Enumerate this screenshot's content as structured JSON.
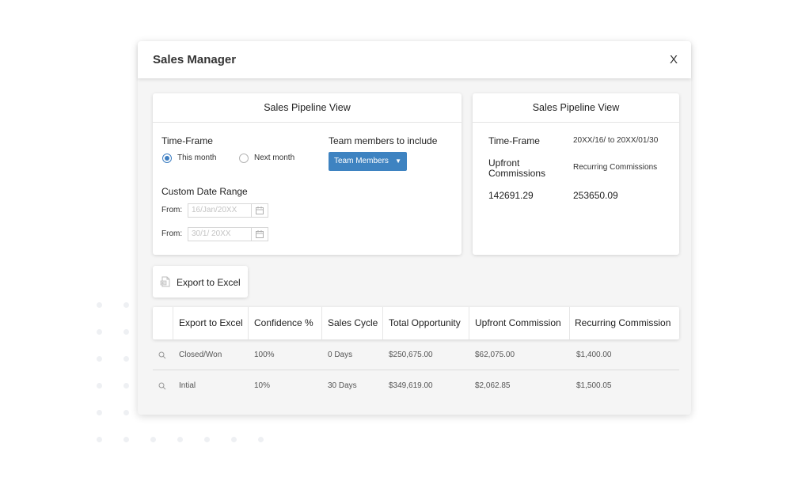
{
  "modal": {
    "title": "Sales Manager",
    "close_label": "X"
  },
  "filter_card": {
    "title": "Sales Pipeline View",
    "timeframe_label": "Time-Frame",
    "timeframe_options": [
      "This month",
      "Next month"
    ],
    "timeframe_selected": "This month",
    "team_label": "Team members to include",
    "team_button": "Team Members",
    "custom_range_label": "Custom Date Range",
    "from_label_1": "From:",
    "from_value_1": "16/Jan/20XX",
    "from_label_2": "From:",
    "from_value_2": "30/1/ 20XX"
  },
  "summary_card": {
    "title": "Sales Pipeline View",
    "timeframe_label": "Time-Frame",
    "timeframe_value": "20XX/16/ to 20XX/01/30",
    "upfront_label": "Upfront Commissions",
    "recurring_label": "Recurring Commissions",
    "upfront_value": "142691.29",
    "recurring_value": "253650.09"
  },
  "export_button": "Export to Excel",
  "table": {
    "columns": [
      "Export to Excel",
      "Confidence %",
      "Sales Cycle",
      "Total Opportunity",
      "Upfront Commission",
      "Recurring Commission"
    ],
    "rows": [
      [
        "Closed/Won",
        "100%",
        "0 Days",
        "$250,675.00",
        "$62,075.00",
        "$1,400.00"
      ],
      [
        "Intial",
        "10%",
        "30 Days",
        "$349,619.00",
        "$2,062.85",
        "$1,500.05"
      ]
    ]
  },
  "icons": {
    "close": "close-icon",
    "calendar": "calendar-icon",
    "excel": "excel-file-icon",
    "search": "search-icon",
    "dropdown": "caret-down-icon"
  },
  "colors": {
    "accent": "#3e83c1",
    "modal_bg": "#f5f5f5"
  }
}
